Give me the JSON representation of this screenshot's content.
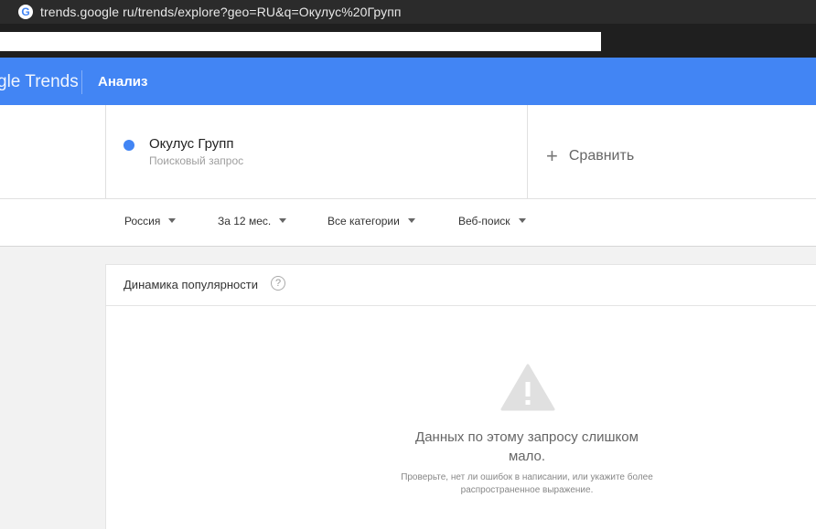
{
  "browser": {
    "url": "trends.google ru/trends/explore?geo=RU&q=Окулус%20Групп",
    "site_icon": "google-g-icon"
  },
  "appbar": {
    "logo": "gle Trends",
    "section": "Анализ",
    "color": "#4285f4"
  },
  "term": {
    "name": "Окулус Групп",
    "type": "Поисковый запрос",
    "dot_color": "#4285f4"
  },
  "compare": {
    "icon": "+",
    "label": "Сравнить"
  },
  "filters": [
    {
      "label": "Россия"
    },
    {
      "label": "За 12 мес."
    },
    {
      "label": "Все категории"
    },
    {
      "label": "Веб-поиск"
    }
  ],
  "card": {
    "title": "Динамика популярности",
    "help_icon": "?",
    "message": "Данных по этому запросу слишком мало.",
    "hint": "Проверьте, нет ли ошибок в написании, или укажите более распространенное выражение."
  }
}
